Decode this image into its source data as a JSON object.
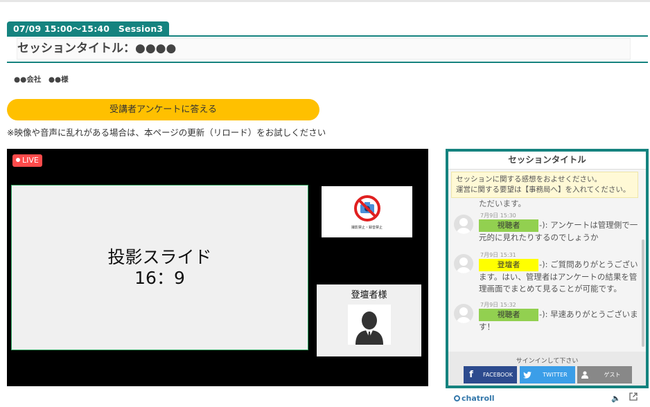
{
  "session": {
    "tag": "07/09 15:00～15:40　Session3",
    "title": "セッションタイトル：●●●●",
    "company": "●●会社　●●様"
  },
  "survey_button": "受講者アンケートに答える",
  "notice": "※映像や音声に乱れがある場合は、本ページの更新（リロード）をお試しください",
  "video": {
    "live_label": "LIVE",
    "slide_line1": "投影スライド",
    "slide_line2": "16：9",
    "nophoto_caption": "撮影禁止・録音禁止",
    "speaker_name": "登壇者様"
  },
  "chat": {
    "title": "セッションタイトル",
    "notice_line1": "セッションに関する感想をおよせください。",
    "notice_line2": "運営に関する要望は【事務局へ】を入れてください。",
    "prev_fragment": "ただいます。",
    "messages": [
      {
        "time": "7月9日 15:30",
        "role": "視聴者",
        "text": "-): アンケートは管理側で一元的に見れたりするのでしょうか"
      },
      {
        "time": "7月9日 15:31",
        "role": "登壇者",
        "text": "-): ご質問ありがとうございます。はい、管理者はアンケートの結果を管理画面でまとめて見ることが可能です。"
      },
      {
        "time": "7月9日 15:32",
        "role": "視聴者",
        "text": "-): 早速ありがとうございます！"
      }
    ],
    "signin_label": "サインインして下さい",
    "facebook": "FACEBOOK",
    "twitter": "TWITTER",
    "guest": "ゲスト"
  },
  "footer": {
    "brand": "chatroll"
  },
  "colors": {
    "accent": "#15837f",
    "survey": "#ffc000",
    "live": "#ff4b4b",
    "viewer": "#92d050",
    "presenter": "#ffff00"
  }
}
